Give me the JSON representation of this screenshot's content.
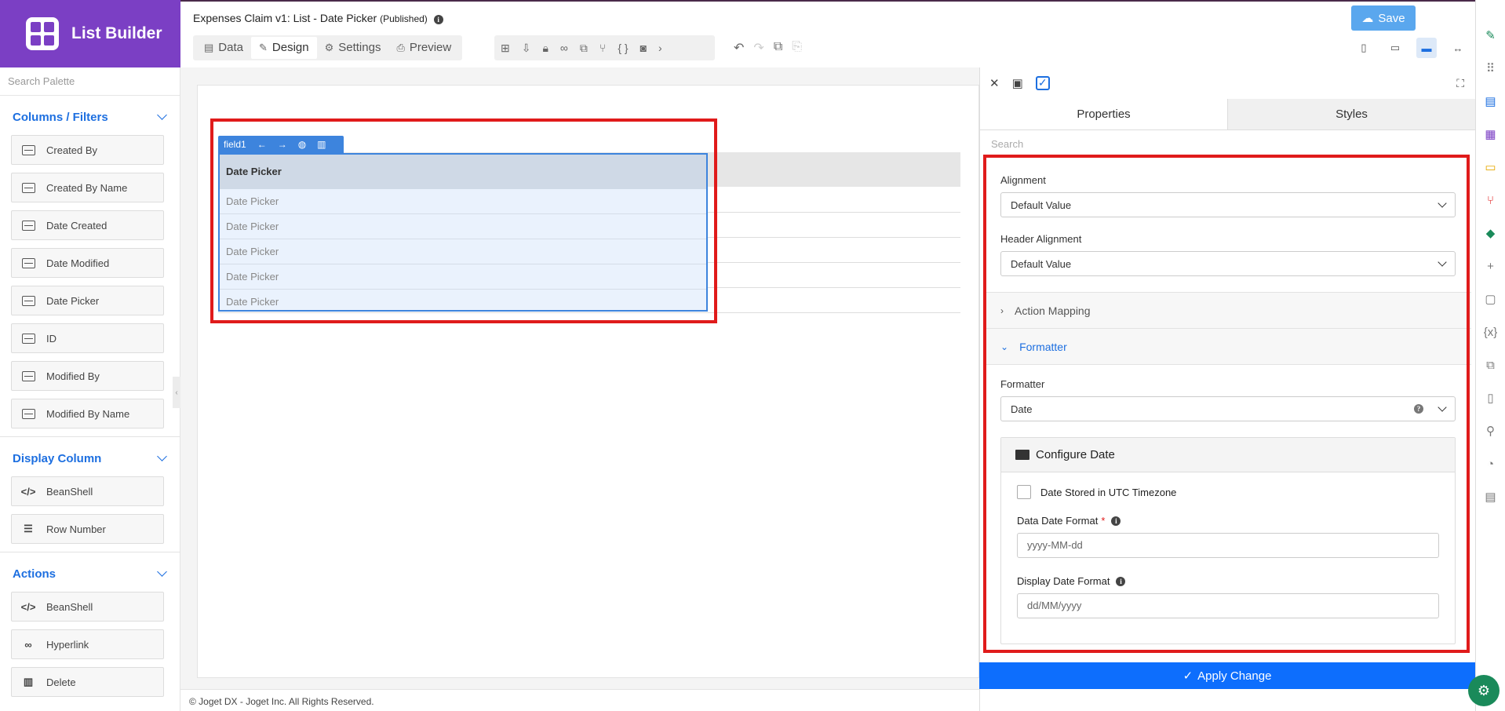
{
  "app": {
    "title": "List Builder",
    "page_title": "Expenses Claim v1: List - Date Picker",
    "status": "(Published)"
  },
  "header": {
    "tabs": [
      {
        "label": "Data",
        "icon": "table-icon"
      },
      {
        "label": "Design",
        "icon": "design-icon"
      },
      {
        "label": "Settings",
        "icon": "gear-icon"
      },
      {
        "label": "Preview",
        "icon": "preview-icon"
      }
    ],
    "active_tab": "Design",
    "save_label": "Save"
  },
  "sidebar": {
    "search_placeholder": "Search Palette",
    "sections": [
      {
        "title": "Columns / Filters",
        "items": [
          "Created By",
          "Created By Name",
          "Date Created",
          "Date Modified",
          "Date Picker",
          "ID",
          "Modified By",
          "Modified By Name"
        ]
      },
      {
        "title": "Display Column",
        "items": [
          "BeanShell",
          "Row Number"
        ]
      },
      {
        "title": "Actions",
        "items": [
          "BeanShell",
          "Hyperlink",
          "Delete"
        ]
      }
    ]
  },
  "canvas": {
    "field_tag": "field1",
    "column_header": "Date Picker",
    "rows": [
      "Date Picker",
      "Date Picker",
      "Date Picker",
      "Date Picker",
      "Date Picker"
    ]
  },
  "footer": {
    "text": "© Joget DX - Joget Inc. All Rights Reserved."
  },
  "properties": {
    "tabs": [
      "Properties",
      "Styles"
    ],
    "search_placeholder": "Search",
    "alignment_label": "Alignment",
    "alignment_value": "Default Value",
    "header_alignment_label": "Header Alignment",
    "header_alignment_value": "Default Value",
    "action_mapping_label": "Action Mapping",
    "formatter_section_label": "Formatter",
    "formatter_label": "Formatter",
    "formatter_value": "Date",
    "configure_title": "Configure Date",
    "utc_label": "Date Stored in UTC Timezone",
    "data_format_label": "Data Date Format",
    "data_format_value": "yyyy-MM-dd",
    "display_format_label": "Display Date Format",
    "display_format_value": "dd/MM/yyyy",
    "apply_label": "Apply Change"
  },
  "colors": {
    "brand": "#7b3fc4",
    "accent": "#1d6fe0",
    "highlight": "#e01b1b",
    "apply": "#0d6efd"
  }
}
